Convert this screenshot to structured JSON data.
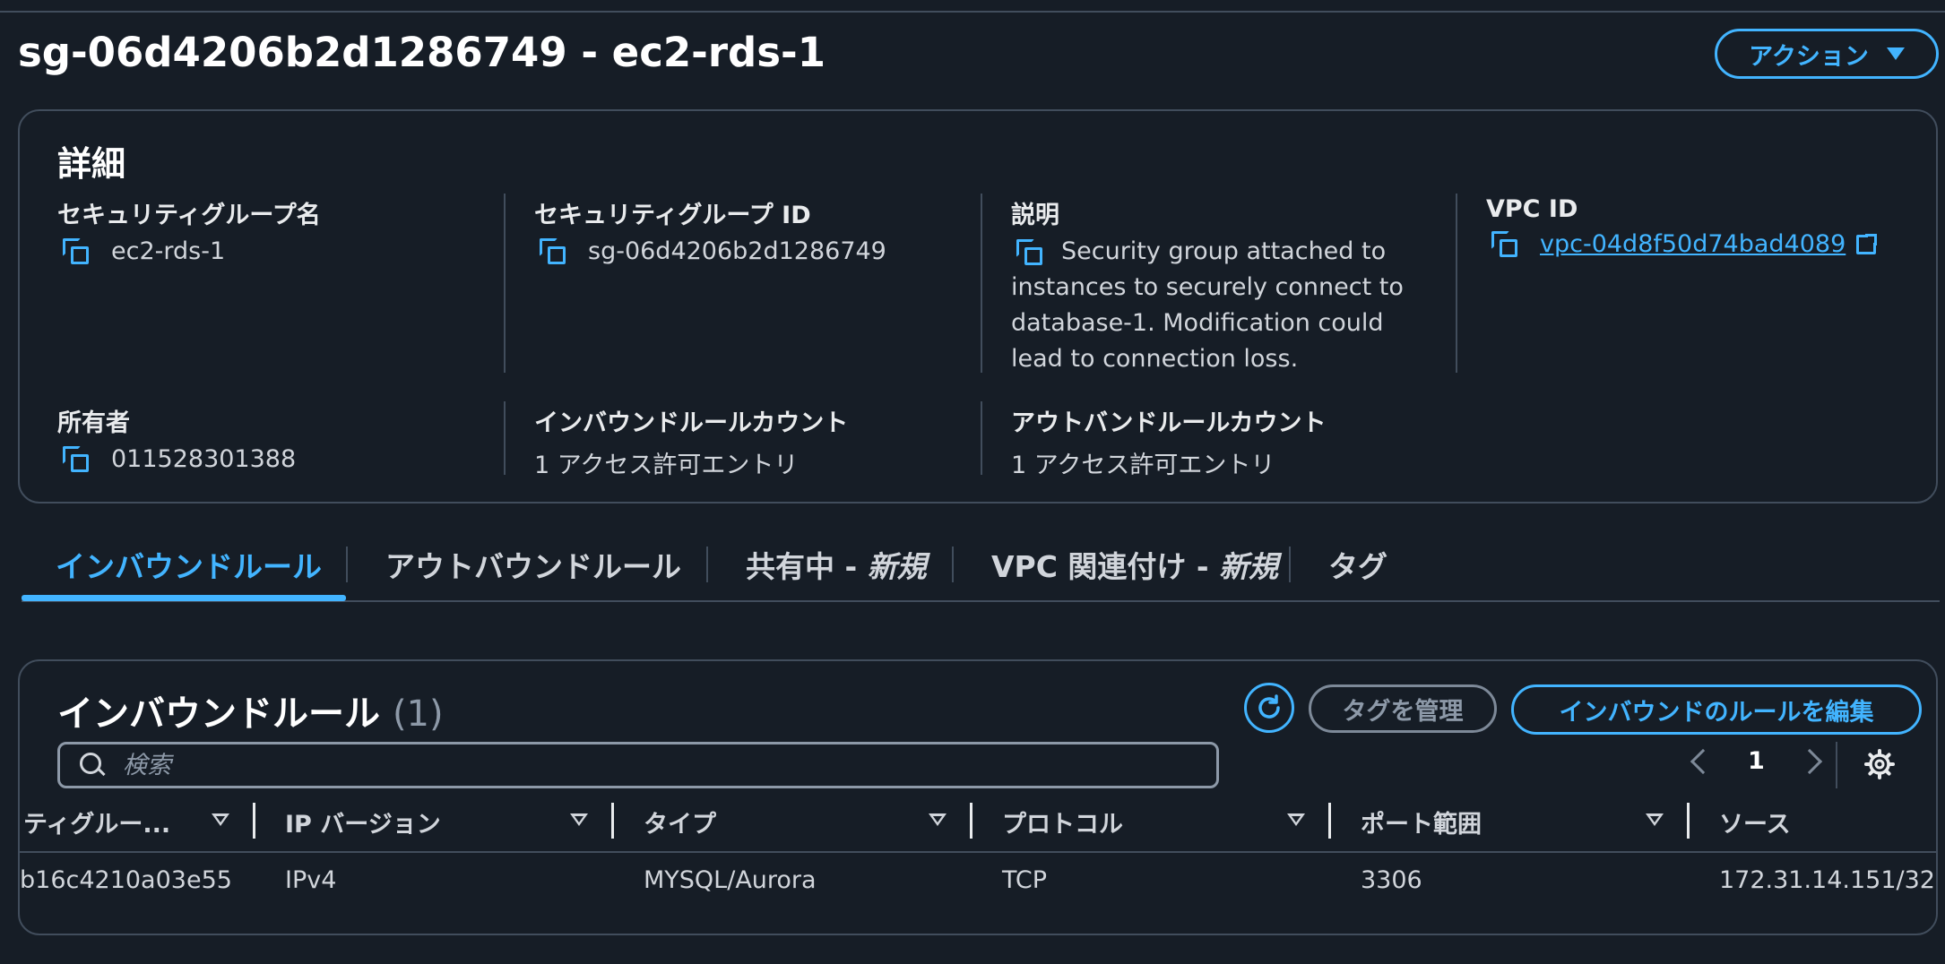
{
  "header": {
    "title": "sg-06d4206b2d1286749 - ec2-rds-1",
    "actions_label": "アクション"
  },
  "details": {
    "title": "詳細",
    "sg_name": {
      "label": "セキュリティグループ名",
      "value": "ec2-rds-1"
    },
    "sg_id": {
      "label": "セキュリティグループ ID",
      "value": "sg-06d4206b2d1286749"
    },
    "description": {
      "label": "説明",
      "value": "Security group attached to instances to securely connect to database-1. Modification could lead to connection loss."
    },
    "vpc_id": {
      "label": "VPC ID",
      "value": "vpc-04d8f50d74bad4089"
    },
    "owner": {
      "label": "所有者",
      "value": "011528301388"
    },
    "inbound_count": {
      "label": "インバウンドルールカウント",
      "value": "1 アクセス許可エントリ"
    },
    "outbound_count": {
      "label": "アウトバンドルールカウント",
      "value": "1 アクセス許可エントリ"
    }
  },
  "tabs": [
    {
      "label": "インバウンドルール"
    },
    {
      "label": "アウトバウンドルール"
    },
    {
      "label": "共有中 - ",
      "tag": "新規"
    },
    {
      "label": "VPC 関連付け - ",
      "tag": "新規"
    },
    {
      "label": "タグ"
    }
  ],
  "rules": {
    "title": "インバウンドルール",
    "count": "(1)",
    "manage_tags_label": "タグを管理",
    "edit_label": "インバウンドのルールを編集",
    "search_placeholder": "検索",
    "page": "1",
    "columns": [
      "ティグルー...",
      "IP バージョン",
      "タイプ",
      "プロトコル",
      "ポート範囲",
      "ソース"
    ],
    "rows": [
      [
        "b16c4210a03e55",
        "IPv4",
        "MYSQL/Aurora",
        "TCP",
        "3306",
        "172.31.14.151/32"
      ]
    ]
  },
  "colors": {
    "background": "#161d26",
    "accent": "#42b4ff",
    "border": "#414d5c"
  },
  "icons": [
    "copy-icon",
    "external-link-icon",
    "refresh-icon",
    "search-icon",
    "chevron-left-icon",
    "chevron-right-icon",
    "gear-icon",
    "caret-down-icon",
    "sort-icon"
  ]
}
